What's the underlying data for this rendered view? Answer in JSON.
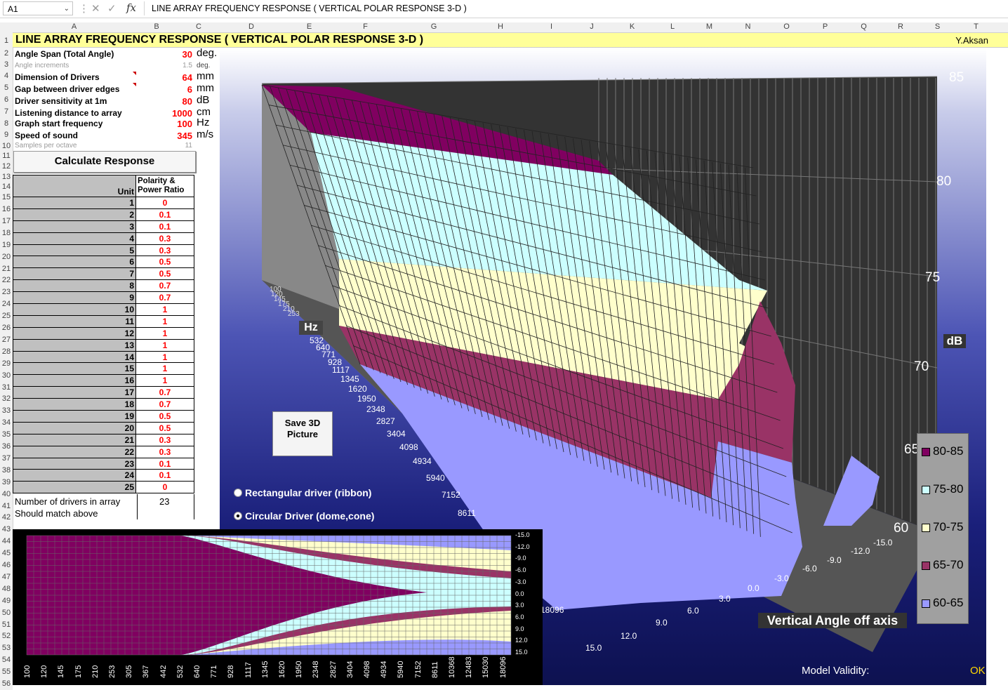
{
  "formula_bar": {
    "name_box": "A1",
    "fx": "fx",
    "formula": "LINE ARRAY FREQUENCY RESPONSE ( VERTICAL POLAR RESPONSE 3-D )"
  },
  "columns": [
    "A",
    "B",
    "C",
    "D",
    "E",
    "F",
    "G",
    "H",
    "I",
    "J",
    "K",
    "L",
    "M",
    "N",
    "O",
    "P",
    "Q",
    "R",
    "S",
    "T"
  ],
  "sheet": {
    "title": "LINE ARRAY FREQUENCY RESPONSE ( VERTICAL POLAR RESPONSE 3-D )",
    "author": "Y.Aksan",
    "params": [
      {
        "label": "Angle Span (Total Angle)",
        "value": "30",
        "unit": "deg."
      },
      {
        "label": "Angle increments",
        "value": "1.5",
        "unit": "deg."
      },
      {
        "label": "Dimension of Drivers",
        "value": "64",
        "unit": "mm"
      },
      {
        "label": "Gap between driver edges",
        "value": "6",
        "unit": "mm"
      },
      {
        "label": "Driver sensitivity at 1m",
        "value": "80",
        "unit": "dB"
      },
      {
        "label": "Listening distance to array",
        "value": "1000",
        "unit": "cm"
      },
      {
        "label": "Graph start frequency",
        "value": "100",
        "unit": "Hz"
      },
      {
        "label": "Speed of sound",
        "value": "345",
        "unit": "m/s"
      },
      {
        "label": "Samples per octave",
        "value": "11",
        "unit": ""
      }
    ],
    "calc_button": "Calculate Response",
    "table_header": {
      "unit": "Unit",
      "polarity": "Polarity & Power Ratio"
    },
    "units": [
      {
        "unit": "1",
        "p": "0"
      },
      {
        "unit": "2",
        "p": "0.1"
      },
      {
        "unit": "3",
        "p": "0.1"
      },
      {
        "unit": "4",
        "p": "0.3"
      },
      {
        "unit": "5",
        "p": "0.3"
      },
      {
        "unit": "6",
        "p": "0.5"
      },
      {
        "unit": "7",
        "p": "0.5"
      },
      {
        "unit": "8",
        "p": "0.7"
      },
      {
        "unit": "9",
        "p": "0.7"
      },
      {
        "unit": "10",
        "p": "1"
      },
      {
        "unit": "11",
        "p": "1"
      },
      {
        "unit": "12",
        "p": "1"
      },
      {
        "unit": "13",
        "p": "1"
      },
      {
        "unit": "14",
        "p": "1"
      },
      {
        "unit": "15",
        "p": "1"
      },
      {
        "unit": "16",
        "p": "1"
      },
      {
        "unit": "17",
        "p": "0.7"
      },
      {
        "unit": "18",
        "p": "0.7"
      },
      {
        "unit": "19",
        "p": "0.5"
      },
      {
        "unit": "20",
        "p": "0.5"
      },
      {
        "unit": "21",
        "p": "0.3"
      },
      {
        "unit": "22",
        "p": "0.3"
      },
      {
        "unit": "23",
        "p": "0.1"
      },
      {
        "unit": "24",
        "p": "0.1"
      },
      {
        "unit": "25",
        "p": "0"
      }
    ],
    "driver_count_label": "Number of drivers in array",
    "driver_count_value": "23",
    "match_label": "Should match above"
  },
  "chart3d": {
    "z_ticks": [
      "85",
      "80",
      "75",
      "70",
      "65",
      "60"
    ],
    "z_axis_label": "dB",
    "freq_axis_label": "Hz",
    "freq_ticks": [
      "100",
      "120",
      "145",
      "175",
      "210",
      "253",
      "532",
      "640",
      "771",
      "928",
      "1117",
      "1345",
      "1620",
      "1950",
      "2348",
      "2827",
      "3404",
      "4098",
      "4934",
      "5940",
      "7152",
      "8611",
      "18096"
    ],
    "angle_ticks": [
      "-15.0",
      "-12.0",
      "-9.0",
      "-6.0",
      "-3.0",
      "0.0",
      "3.0",
      "6.0",
      "9.0",
      "12.0",
      "15.0"
    ],
    "angle_axis_label": "Vertical Angle off axis",
    "legend": [
      {
        "label": "80-85",
        "color": "#800060"
      },
      {
        "label": "75-80",
        "color": "#ccffff"
      },
      {
        "label": "70-75",
        "color": "#ffffcc"
      },
      {
        "label": "65-70",
        "color": "#993366"
      },
      {
        "label": "60-65",
        "color": "#9999ff"
      }
    ],
    "save_button": "Save 3D Picture",
    "radio_rect": "Rectangular driver (ribbon)",
    "radio_circ": "Circular Driver (dome,cone)",
    "validity_label": "Model Validity:",
    "validity_value": "OK"
  },
  "contour": {
    "y_ticks": [
      "-15.0",
      "-12.0",
      "-9.0",
      "-6.0",
      "-3.0",
      "0.0",
      "3.0",
      "6.0",
      "9.0",
      "12.0",
      "15.0"
    ],
    "x_ticks": [
      "100",
      "120",
      "145",
      "175",
      "210",
      "253",
      "305",
      "367",
      "442",
      "532",
      "640",
      "771",
      "928",
      "1117",
      "1345",
      "1620",
      "1950",
      "2348",
      "2827",
      "3404",
      "4098",
      "4934",
      "5940",
      "7152",
      "8611",
      "10368",
      "12483",
      "15030",
      "18096"
    ]
  }
}
